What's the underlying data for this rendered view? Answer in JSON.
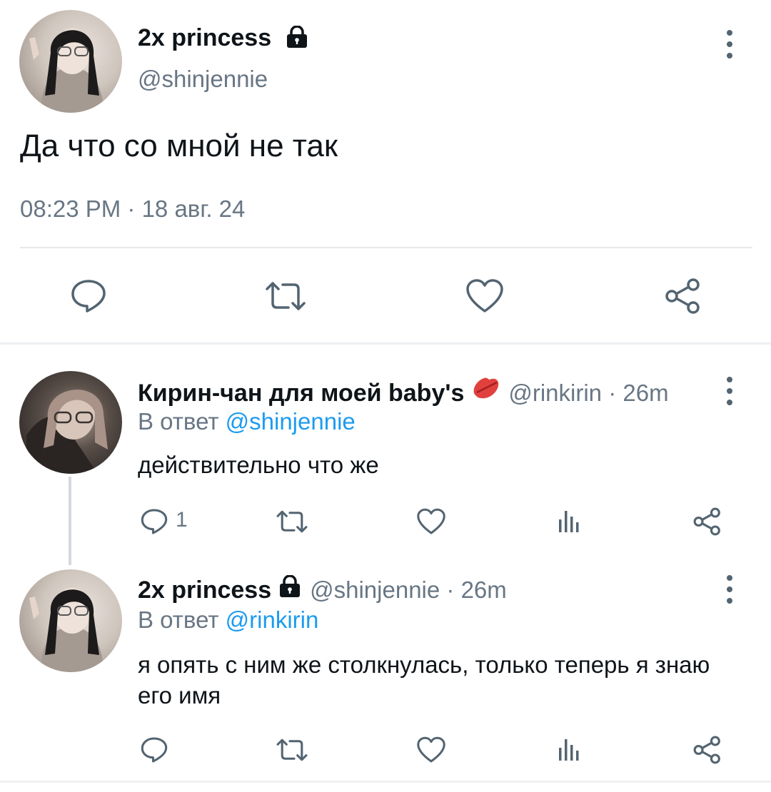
{
  "main_tweet": {
    "display_name": "2x princess",
    "handle": "@shinjennie",
    "text": "Да что со мной не так",
    "timestamp": "08:23 PM · 18 авг. 24",
    "actions": [
      "reply-icon",
      "retweet-icon",
      "like-icon",
      "share-icon"
    ]
  },
  "replies": [
    {
      "display_name": "Кирин-чан для моей baby's",
      "badge_icon": "lips-emoji-icon",
      "meta": "@rinkirin · 26m",
      "reply_to_label": "В ответ",
      "reply_to_handle": "@shinjennie",
      "text": "действительно что же",
      "reply_count": "1"
    },
    {
      "display_name": "2x princess",
      "badge_icon": "lock-icon",
      "meta": "@shinjennie · 26m",
      "reply_to_label": "В ответ",
      "reply_to_handle": "@rinkirin",
      "text": "я опять с ним же столкнулась, только теперь я знаю его имя",
      "reply_count": ""
    }
  ],
  "colors": {
    "text": "#0f1419",
    "secondary": "#687684",
    "link": "#1d9bf0",
    "icon": "#536471",
    "lips": "#e0413f"
  }
}
